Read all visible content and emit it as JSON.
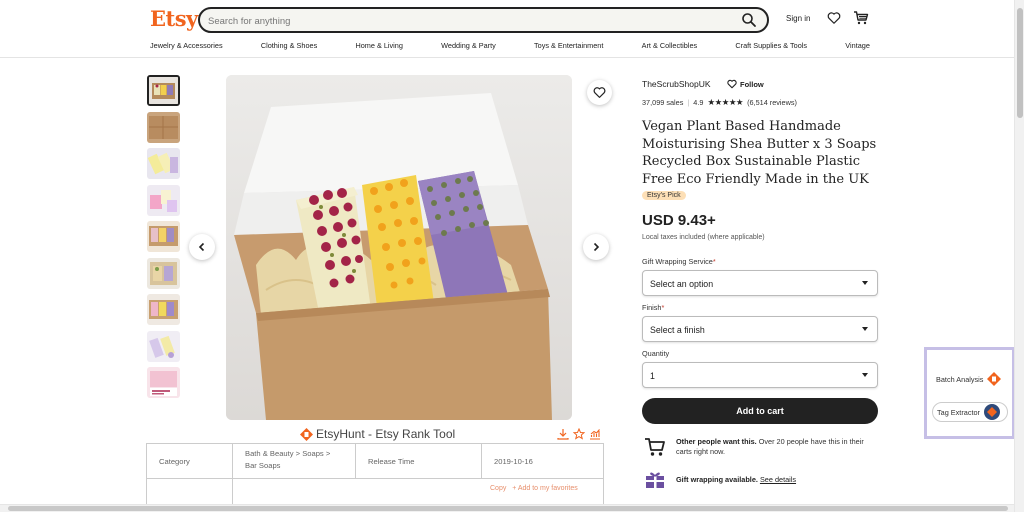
{
  "header": {
    "logo": "Etsy",
    "search_placeholder": "Search for anything",
    "sign_in": "Sign in"
  },
  "nav": [
    "Jewelry & Accessories",
    "Clothing & Shoes",
    "Home & Living",
    "Wedding & Party",
    "Toys & Entertainment",
    "Art & Collectibles",
    "Craft Supplies & Tools",
    "Vintage"
  ],
  "shop": {
    "name": "TheScrubShopUK",
    "follow": "Follow",
    "sales": "37,099 sales",
    "rating": "4.9",
    "reviews": "(6,514 reviews)"
  },
  "product": {
    "title": "Vegan Plant Based Handmade Moisturising Shea Butter x 3 Soaps Recycled Box Sustainable Plastic Free Eco Friendly Made in the UK",
    "badge": "Etsy's Pick",
    "price": "USD 9.43+",
    "tax_note": "Local taxes included (where applicable)"
  },
  "options": {
    "gift_label": "Gift Wrapping Service",
    "gift_value": "Select an option",
    "finish_label": "Finish",
    "finish_value": "Select a finish",
    "quantity_label": "Quantity",
    "quantity_value": "1",
    "required_mark": "*"
  },
  "add_to_cart": "Add to cart",
  "info": {
    "demand_bold": "Other people want this.",
    "demand_rest": " Over 20 people have this in their carts right now.",
    "gift_bold": "Gift wrapping available.",
    "gift_link": "See details"
  },
  "etsyhunt": {
    "title": "EtsyHunt - Etsy Rank Tool",
    "category_label": "Category",
    "category_value": "Bath & Beauty > Soaps > Bar Soaps",
    "release_label": "Release Time",
    "release_value": "2019-10-16",
    "copy": "Copy",
    "add_fav": "+ Add to my favorites"
  },
  "extension": {
    "batch": "Batch Analysis",
    "tag": "Tag Extractor"
  },
  "colors": {
    "brand": "#f1641e",
    "badge": "#fddfb6",
    "widget_border": "#c6bfe6"
  }
}
